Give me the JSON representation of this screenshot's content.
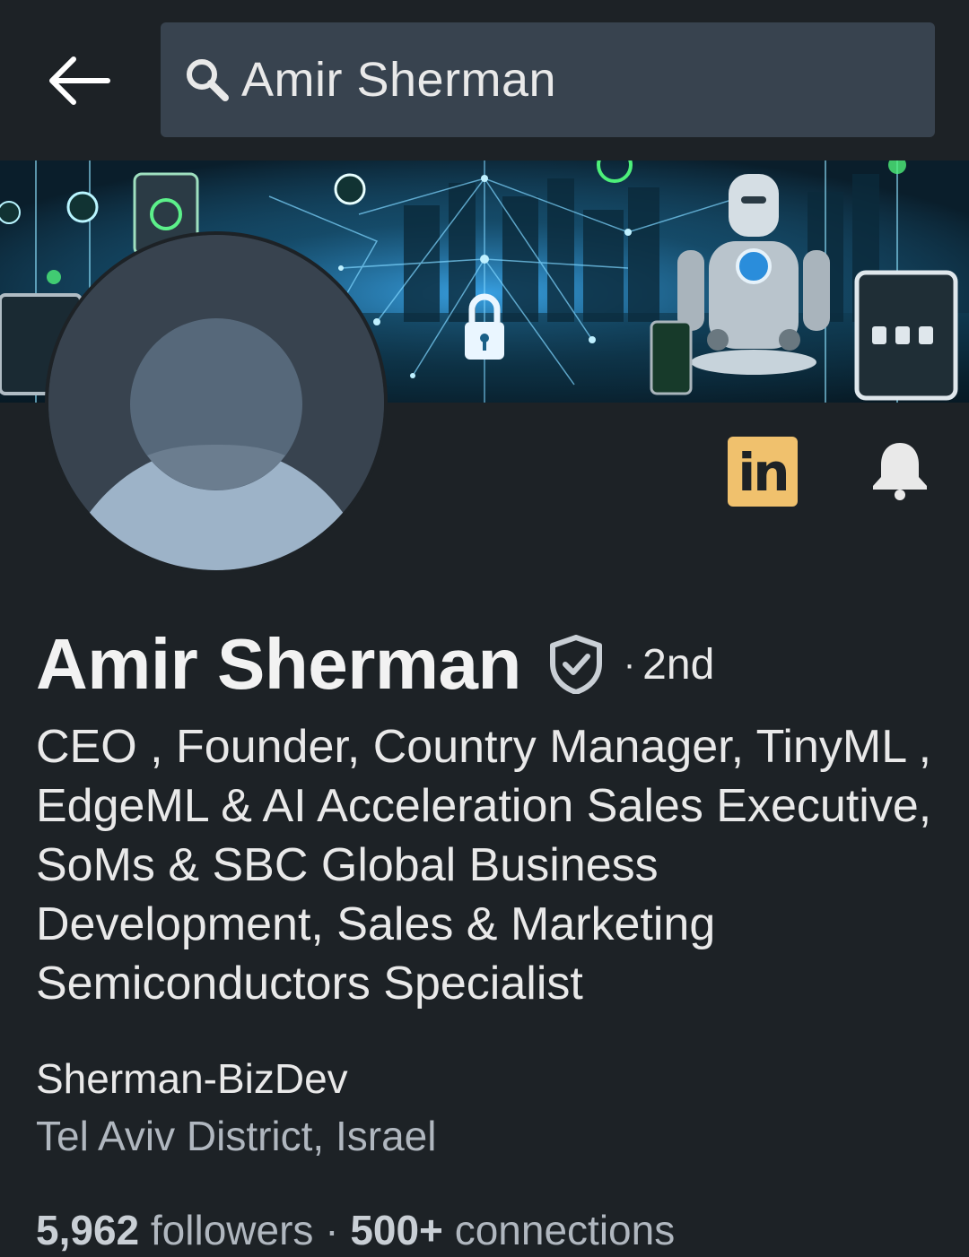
{
  "search": {
    "query": "Amir Sherman"
  },
  "profile": {
    "name": "Amir Sherman",
    "degree_separator": "·",
    "degree": "2nd",
    "headline": "CEO , Founder, Country Manager, TinyML , EdgeML & AI Acceleration Sales Executive, SoMs & SBC Global Business Development, Sales & Marketing Semiconductors Specialist",
    "company": "Sherman-BizDev",
    "location": "Tel Aviv District, Israel",
    "followers_count": "5,962",
    "followers_label": "followers",
    "stats_separator": "·",
    "connections_count": "500+",
    "connections_label": "connections"
  },
  "actions": {
    "linkedin_label": "in"
  },
  "icons": {
    "back": "arrow-left-icon",
    "search": "search-icon",
    "verified": "verified-shield-icon",
    "bell": "bell-icon",
    "linkedin": "linkedin-logo-icon"
  },
  "colors": {
    "background": "#1d2226",
    "search_field": "#38434f",
    "linkedin_badge": "#f0c16d",
    "primary_text": "#e9e9e9",
    "secondary_text": "#b0b7bf"
  }
}
